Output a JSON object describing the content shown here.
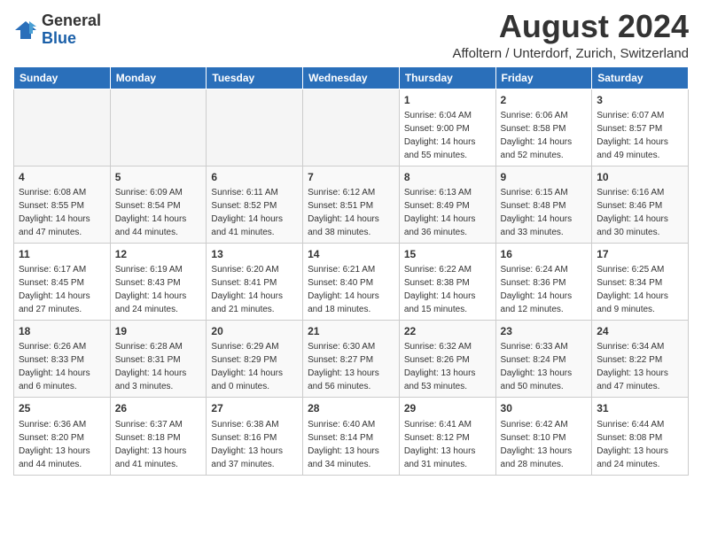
{
  "header": {
    "logo_general": "General",
    "logo_blue": "Blue",
    "month_year": "August 2024",
    "location": "Affoltern / Unterdorf, Zurich, Switzerland"
  },
  "weekdays": [
    "Sunday",
    "Monday",
    "Tuesday",
    "Wednesday",
    "Thursday",
    "Friday",
    "Saturday"
  ],
  "weeks": [
    [
      {
        "day": "",
        "info": ""
      },
      {
        "day": "",
        "info": ""
      },
      {
        "day": "",
        "info": ""
      },
      {
        "day": "",
        "info": ""
      },
      {
        "day": "1",
        "info": "Sunrise: 6:04 AM\nSunset: 9:00 PM\nDaylight: 14 hours\nand 55 minutes."
      },
      {
        "day": "2",
        "info": "Sunrise: 6:06 AM\nSunset: 8:58 PM\nDaylight: 14 hours\nand 52 minutes."
      },
      {
        "day": "3",
        "info": "Sunrise: 6:07 AM\nSunset: 8:57 PM\nDaylight: 14 hours\nand 49 minutes."
      }
    ],
    [
      {
        "day": "4",
        "info": "Sunrise: 6:08 AM\nSunset: 8:55 PM\nDaylight: 14 hours\nand 47 minutes."
      },
      {
        "day": "5",
        "info": "Sunrise: 6:09 AM\nSunset: 8:54 PM\nDaylight: 14 hours\nand 44 minutes."
      },
      {
        "day": "6",
        "info": "Sunrise: 6:11 AM\nSunset: 8:52 PM\nDaylight: 14 hours\nand 41 minutes."
      },
      {
        "day": "7",
        "info": "Sunrise: 6:12 AM\nSunset: 8:51 PM\nDaylight: 14 hours\nand 38 minutes."
      },
      {
        "day": "8",
        "info": "Sunrise: 6:13 AM\nSunset: 8:49 PM\nDaylight: 14 hours\nand 36 minutes."
      },
      {
        "day": "9",
        "info": "Sunrise: 6:15 AM\nSunset: 8:48 PM\nDaylight: 14 hours\nand 33 minutes."
      },
      {
        "day": "10",
        "info": "Sunrise: 6:16 AM\nSunset: 8:46 PM\nDaylight: 14 hours\nand 30 minutes."
      }
    ],
    [
      {
        "day": "11",
        "info": "Sunrise: 6:17 AM\nSunset: 8:45 PM\nDaylight: 14 hours\nand 27 minutes."
      },
      {
        "day": "12",
        "info": "Sunrise: 6:19 AM\nSunset: 8:43 PM\nDaylight: 14 hours\nand 24 minutes."
      },
      {
        "day": "13",
        "info": "Sunrise: 6:20 AM\nSunset: 8:41 PM\nDaylight: 14 hours\nand 21 minutes."
      },
      {
        "day": "14",
        "info": "Sunrise: 6:21 AM\nSunset: 8:40 PM\nDaylight: 14 hours\nand 18 minutes."
      },
      {
        "day": "15",
        "info": "Sunrise: 6:22 AM\nSunset: 8:38 PM\nDaylight: 14 hours\nand 15 minutes."
      },
      {
        "day": "16",
        "info": "Sunrise: 6:24 AM\nSunset: 8:36 PM\nDaylight: 14 hours\nand 12 minutes."
      },
      {
        "day": "17",
        "info": "Sunrise: 6:25 AM\nSunset: 8:34 PM\nDaylight: 14 hours\nand 9 minutes."
      }
    ],
    [
      {
        "day": "18",
        "info": "Sunrise: 6:26 AM\nSunset: 8:33 PM\nDaylight: 14 hours\nand 6 minutes."
      },
      {
        "day": "19",
        "info": "Sunrise: 6:28 AM\nSunset: 8:31 PM\nDaylight: 14 hours\nand 3 minutes."
      },
      {
        "day": "20",
        "info": "Sunrise: 6:29 AM\nSunset: 8:29 PM\nDaylight: 14 hours\nand 0 minutes."
      },
      {
        "day": "21",
        "info": "Sunrise: 6:30 AM\nSunset: 8:27 PM\nDaylight: 13 hours\nand 56 minutes."
      },
      {
        "day": "22",
        "info": "Sunrise: 6:32 AM\nSunset: 8:26 PM\nDaylight: 13 hours\nand 53 minutes."
      },
      {
        "day": "23",
        "info": "Sunrise: 6:33 AM\nSunset: 8:24 PM\nDaylight: 13 hours\nand 50 minutes."
      },
      {
        "day": "24",
        "info": "Sunrise: 6:34 AM\nSunset: 8:22 PM\nDaylight: 13 hours\nand 47 minutes."
      }
    ],
    [
      {
        "day": "25",
        "info": "Sunrise: 6:36 AM\nSunset: 8:20 PM\nDaylight: 13 hours\nand 44 minutes."
      },
      {
        "day": "26",
        "info": "Sunrise: 6:37 AM\nSunset: 8:18 PM\nDaylight: 13 hours\nand 41 minutes."
      },
      {
        "day": "27",
        "info": "Sunrise: 6:38 AM\nSunset: 8:16 PM\nDaylight: 13 hours\nand 37 minutes."
      },
      {
        "day": "28",
        "info": "Sunrise: 6:40 AM\nSunset: 8:14 PM\nDaylight: 13 hours\nand 34 minutes."
      },
      {
        "day": "29",
        "info": "Sunrise: 6:41 AM\nSunset: 8:12 PM\nDaylight: 13 hours\nand 31 minutes."
      },
      {
        "day": "30",
        "info": "Sunrise: 6:42 AM\nSunset: 8:10 PM\nDaylight: 13 hours\nand 28 minutes."
      },
      {
        "day": "31",
        "info": "Sunrise: 6:44 AM\nSunset: 8:08 PM\nDaylight: 13 hours\nand 24 minutes."
      }
    ]
  ]
}
